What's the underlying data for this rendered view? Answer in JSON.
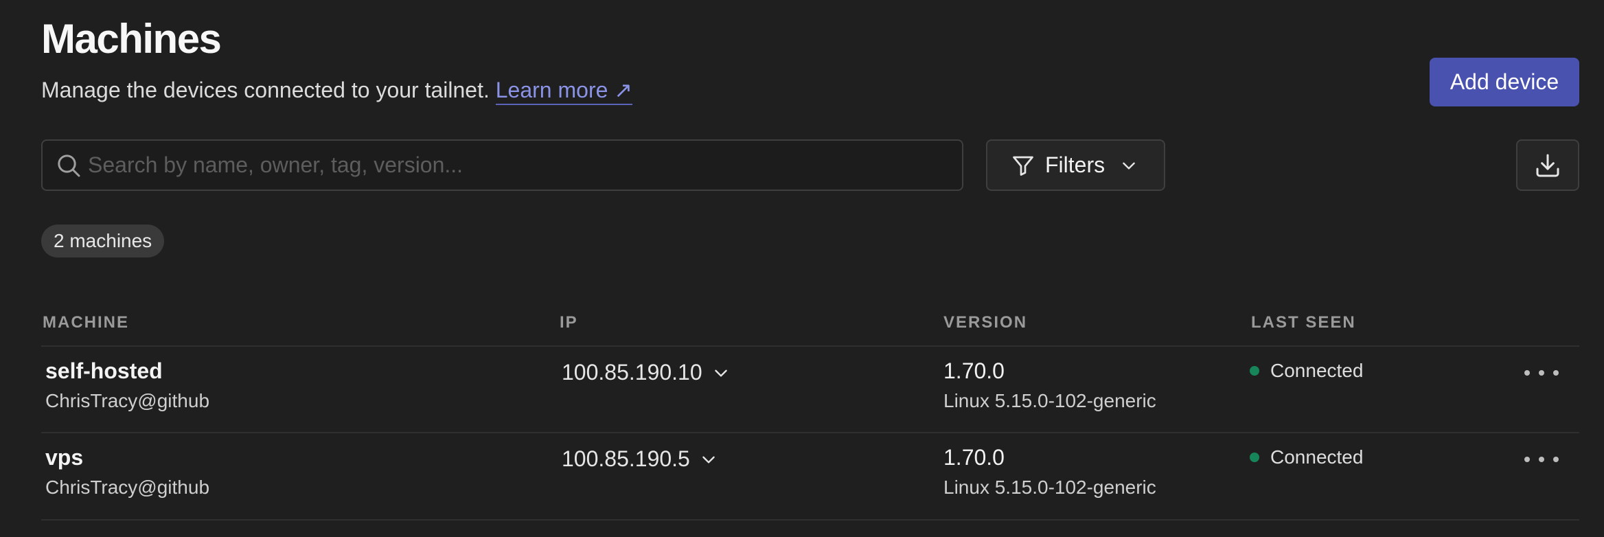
{
  "header": {
    "title": "Machines",
    "subtitle": "Manage the devices connected to your tailnet.",
    "learn_more": "Learn more ↗",
    "add_device": "Add device"
  },
  "toolbar": {
    "search_placeholder": "Search by name, owner, tag, version...",
    "search_value": "",
    "filters_label": "Filters",
    "export_icon": "download-icon"
  },
  "machine_count": "2 machines",
  "table": {
    "columns": [
      "MACHINE",
      "IP",
      "VERSION",
      "LAST SEEN"
    ],
    "rows": [
      {
        "name": "self-hosted",
        "owner": "ChrisTracy@github",
        "ip": "100.85.190.10",
        "version": "1.70.0",
        "os": "Linux 5.15.0-102-generic",
        "status": "Connected"
      },
      {
        "name": "vps",
        "owner": "ChrisTracy@github",
        "ip": "100.85.190.5",
        "version": "1.70.0",
        "os": "Linux 5.15.0-102-generic",
        "status": "Connected"
      }
    ]
  },
  "colors": {
    "background": "#1f1f1f",
    "accent": "#4a52b0",
    "link": "#8a93e6",
    "connected": "#17855a"
  }
}
